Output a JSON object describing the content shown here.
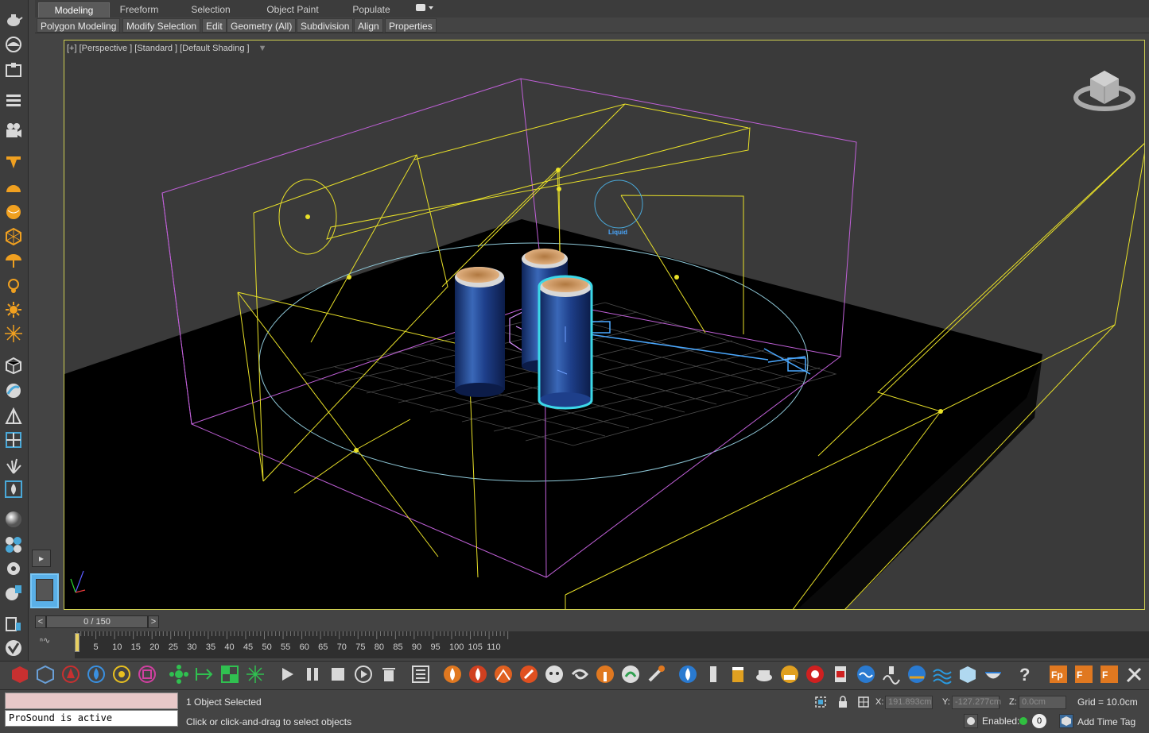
{
  "ribbon": {
    "tabs": [
      "Modeling",
      "Freeform",
      "Selection",
      "Object Paint",
      "Populate"
    ],
    "active_tab": "Modeling",
    "subtabs": [
      "Polygon Modeling",
      "Modify Selection",
      "Edit",
      "Geometry (All)",
      "Subdivision",
      "Align",
      "Properties"
    ]
  },
  "left_toolbar": {
    "icons": [
      "teapot-icon",
      "sphere-shape-icon",
      "box-icon",
      "layers-icon",
      "camera-icon",
      "spot-light-icon",
      "hemisphere-icon",
      "sphere-icon",
      "geosphere-icon",
      "umbrella-light-icon",
      "bulb-light-icon",
      "sun-icon",
      "starburst-icon",
      "cube-icon",
      "ball-icon",
      "tripod-icon",
      "grid-cube-icon",
      "grass-icon",
      "fire-icon",
      "material-sphere-icon",
      "multi-sphere-icon",
      "gear-icon",
      "paint-icon",
      "render-icon",
      "brand-icon"
    ]
  },
  "viewport": {
    "label": "[+] [Perspective ] [Standard ] [Default Shading ]",
    "liquid_label": "Liquid"
  },
  "timeline": {
    "frame_display": "0 / 150",
    "prev_label": "<",
    "next_label": ">",
    "ruler_ticks": [
      "0",
      "5",
      "10",
      "15",
      "20",
      "25",
      "30",
      "35",
      "40",
      "45",
      "50",
      "55",
      "60",
      "65",
      "70",
      "75",
      "80",
      "85",
      "90",
      "95",
      "100",
      "105",
      "110"
    ]
  },
  "status": {
    "script_listener": "",
    "script_output": "ProSound is active",
    "selection_text": "1 Object Selected",
    "prompt_text": "Click or click-and-drag to select objects",
    "x_label": "X:",
    "x_value": "191.893cm",
    "y_label": "Y:",
    "y_value": "-127.277cm",
    "z_label": "Z:",
    "z_value": "0.0cm",
    "grid_text": "Grid = 10.0cm",
    "enabled_label": "Enabled:",
    "enabled_value": "0",
    "add_time_tag": "Add Time Tag"
  },
  "colors": {
    "viewport_border": "#cfcf52",
    "selection_cyan": "#3cd8e8",
    "helper_yellow": "#e8e028",
    "bbox_purple": "#c060d8",
    "can_blue": "#1e3f8a"
  }
}
